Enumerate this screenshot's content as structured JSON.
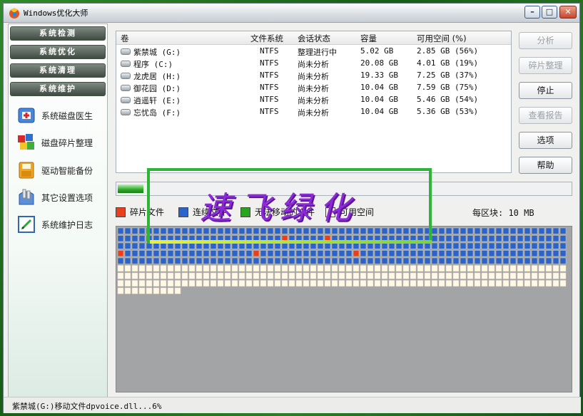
{
  "window": {
    "title": "Windows优化大师",
    "min_glyph": "–",
    "max_glyph": "□",
    "close_glyph": "✕"
  },
  "nav": {
    "tabs": [
      "系统检测",
      "系统优化",
      "系统清理",
      "系统维护"
    ],
    "tools": [
      {
        "label": "系统磁盘医生",
        "icon": "disk-doctor-icon"
      },
      {
        "label": "磁盘碎片整理",
        "icon": "defrag-icon"
      },
      {
        "label": "驱动智能备份",
        "icon": "driver-backup-icon"
      },
      {
        "label": "其它设置选项",
        "icon": "other-settings-icon"
      },
      {
        "label": "系统维护日志",
        "icon": "maintenance-log-icon"
      }
    ]
  },
  "volumes": {
    "headers": [
      "卷",
      "文件系统",
      "会话状态",
      "容量",
      "可用空间 (%)"
    ],
    "rows": [
      {
        "name": "紫禁城 (G:)",
        "fs": "NTFS",
        "status": "整理进行中",
        "capacity": "5.02 GB",
        "free": "2.85 GB (56%)"
      },
      {
        "name": "程序 (C:)",
        "fs": "NTFS",
        "status": "尚未分析",
        "capacity": "20.08 GB",
        "free": "4.01 GB (19%)"
      },
      {
        "name": "龙虎居 (H:)",
        "fs": "NTFS",
        "status": "尚未分析",
        "capacity": "19.33 GB",
        "free": "7.25 GB (37%)"
      },
      {
        "name": "御花园 (D:)",
        "fs": "NTFS",
        "status": "尚未分析",
        "capacity": "10.04 GB",
        "free": "7.59 GB (75%)"
      },
      {
        "name": "逍遥轩 (E:)",
        "fs": "NTFS",
        "status": "尚未分析",
        "capacity": "10.04 GB",
        "free": "5.46 GB (54%)"
      },
      {
        "name": "忘忧岛 (F:)",
        "fs": "NTFS",
        "status": "尚未分析",
        "capacity": "10.04 GB",
        "free": "5.36 GB (53%)"
      }
    ]
  },
  "buttons": {
    "analyze": "分析",
    "defrag": "碎片整理",
    "stop": "停止",
    "report": "查看报告",
    "options": "选项",
    "help": "帮助"
  },
  "progress": {
    "value": 0.06
  },
  "legend": {
    "fragmented": "碎片文件",
    "contiguous": "连续文件",
    "unmovable": "无法移动的文件",
    "free": "可用空间",
    "block_size": "每区块: 10 MB"
  },
  "colors": {
    "fragmented": "#e8401c",
    "contiguous": "#2a63c9",
    "unmovable": "#27a51f",
    "free": "#fff8e6",
    "map_background": "#a2a4a6"
  },
  "disk_map": {
    "columns": 63,
    "rows_data": [
      "CCCCCCCCCCCCCCCCCCCCCCCCCCCCCCCCCCCCCCCCCCCCCCCCCCCCCCCCCCCCCCC",
      "CCCCCCCCCCCCCCCCCCCCCCCFCCCCCFCCCCCCCCCCCCCCCCCCCCCCCCCCCCCCCCC",
      "CCCCCCCCCCCCCCCCCCCCCCCCCCCCCCCCCCCCCCCCCCCCCCCCCCCCCCCCCCCCCCC",
      "FCCCCCCCCCCCCCCCCCCFCCCCCCCCCCCCCFCCCCCCCCCCCCCCCCCCCCCCCCCCCCC",
      "CCCCCCCCCCCCCCCCCCCCCCCCCCCCCCCCCCCCCCCCCCCCCCCCCCCCCCCCCCCCCCC",
      "...............................................................",
      "...............................................................",
      "...............................................................",
      "........."
    ]
  },
  "status_bar": {
    "text": "紫禁城(G:)移动文件dpvoice.dll...6%"
  },
  "watermark": {
    "text": "速飞绿化"
  }
}
